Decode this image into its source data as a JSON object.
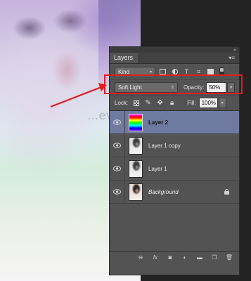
{
  "canvas": {
    "watermark": "...evgb...blog...ot.com"
  },
  "panel": {
    "title": "Layers",
    "filter_kind": "Kind",
    "blend_mode": "Soft Light",
    "opacity_label": "Opacity:",
    "opacity_value": "50%",
    "lock_label": "Lock:",
    "fill_label": "Fill:",
    "fill_value": "100%",
    "filter_icons": [
      "image-filter-icon",
      "adjustment-filter-icon",
      "type-filter-icon",
      "shape-filter-icon",
      "smart-object-filter-icon"
    ],
    "lock_icons": [
      "lock-transparent-icon",
      "lock-image-icon",
      "lock-position-icon",
      "lock-all-icon"
    ],
    "footer_icons": [
      "link-icon",
      "fx-icon",
      "mask-icon",
      "adjustment-icon",
      "group-icon",
      "new-layer-icon",
      "trash-icon"
    ]
  },
  "layers": [
    {
      "name": "Layer 2",
      "selected": true
    },
    {
      "name": "Layer 1 copy",
      "selected": false
    },
    {
      "name": "Layer 1",
      "selected": false
    },
    {
      "name": "Background",
      "selected": false,
      "locked": true
    }
  ],
  "annotation": {
    "highlight_color": "#e41b1b"
  }
}
